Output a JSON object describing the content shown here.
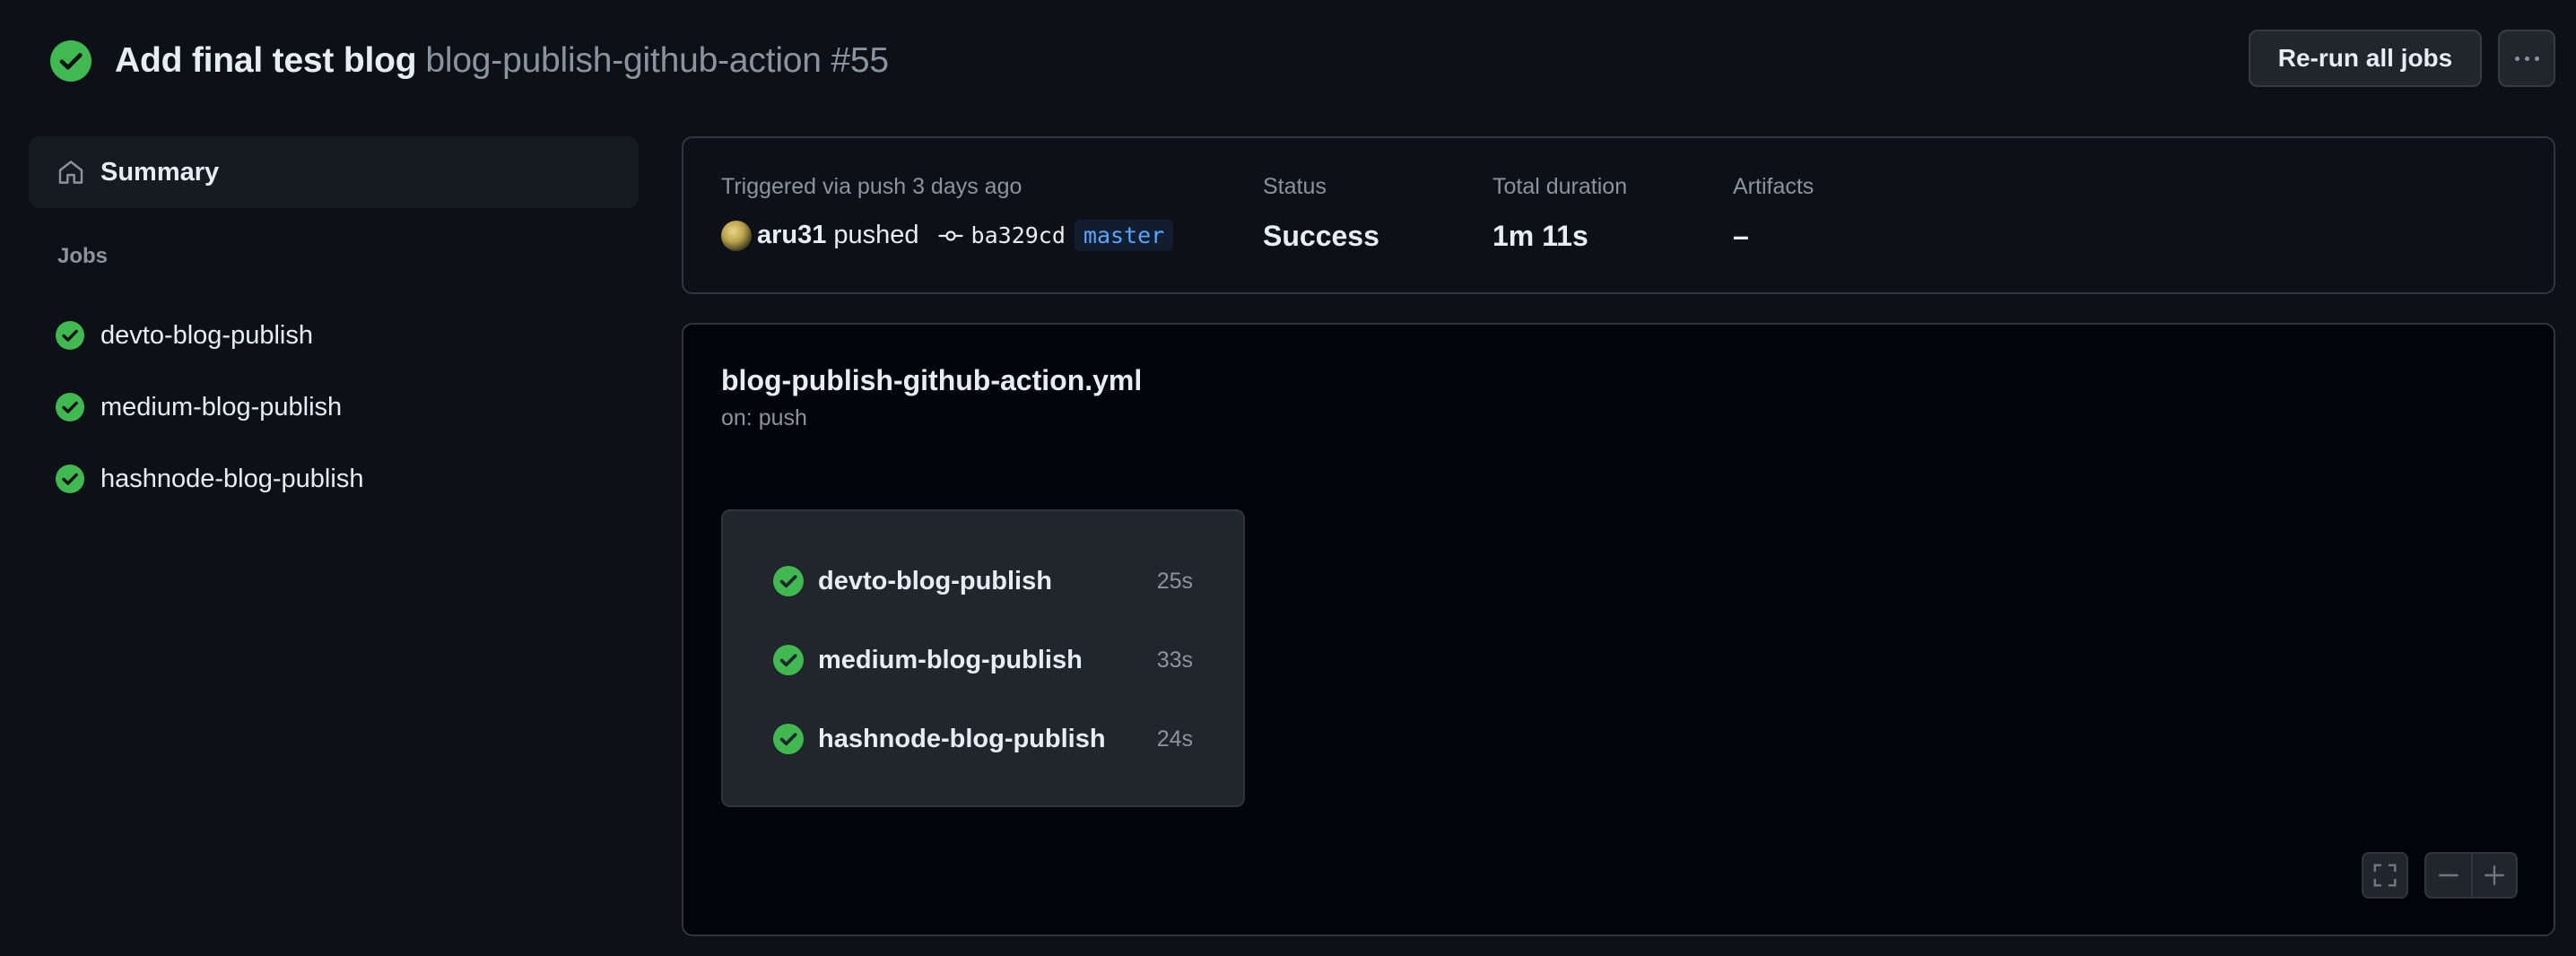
{
  "header": {
    "run_title": "Add final test blog",
    "workflow_run": "blog-publish-github-action #55",
    "rerun_label": "Re-run all jobs",
    "more_icon": "kebab-horizontal-icon",
    "status_icon": "check-circle-fill-icon"
  },
  "colors": {
    "success": "#3fb950",
    "background": "#0d1117",
    "accent_link": "#58a6ff"
  },
  "sidebar": {
    "summary_label": "Summary",
    "summary_icon": "home-icon",
    "jobs_heading": "Jobs",
    "jobs": [
      {
        "label": "devto-blog-publish",
        "status": "success"
      },
      {
        "label": "medium-blog-publish",
        "status": "success"
      },
      {
        "label": "hashnode-blog-publish",
        "status": "success"
      }
    ]
  },
  "info": {
    "triggered_label": "Triggered via push 3 days ago",
    "actor": "aru31",
    "action": "pushed",
    "commit_sha": "ba329cd",
    "branch": "master",
    "status_label": "Status",
    "status_value": "Success",
    "duration_label": "Total duration",
    "duration_value": "1m 11s",
    "artifacts_label": "Artifacts",
    "artifacts_value": "–"
  },
  "graph": {
    "workflow_file": "blog-publish-github-action.yml",
    "trigger": "on: push",
    "jobs": [
      {
        "name": "devto-blog-publish",
        "duration": "25s"
      },
      {
        "name": "medium-blog-publish",
        "duration": "33s"
      },
      {
        "name": "hashnode-blog-publish",
        "duration": "24s"
      }
    ],
    "tools": [
      "fullscreen-icon",
      "zoom-out-icon",
      "zoom-in-icon"
    ]
  }
}
